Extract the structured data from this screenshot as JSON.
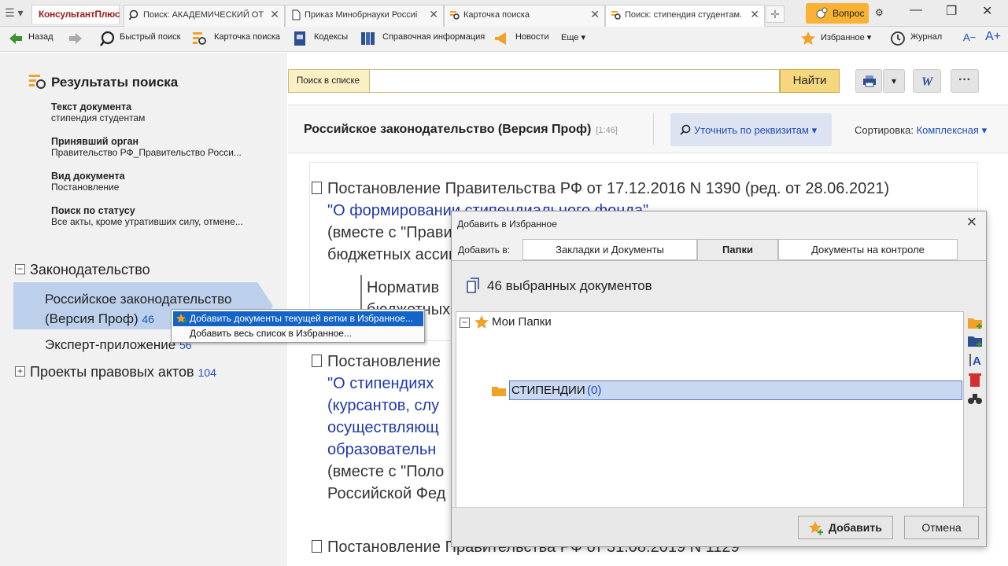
{
  "tabs": {
    "brand": "КонсультантПлюс",
    "items": [
      {
        "label": "Поиск: АКАДЕМИЧЕСКИЙ ОТ"
      },
      {
        "label": "Приказ Минобрнауки Россиі"
      },
      {
        "label": "Карточка поиска"
      },
      {
        "label": "Поиск: стипендия студентам."
      }
    ],
    "question_button": "Вопрос"
  },
  "toolbar": {
    "back": "Назад",
    "quick_search": "Быстрый поиск",
    "search_card": "Карточка поиска",
    "codexes": "Кодексы",
    "reference": "Справочная информация",
    "news": "Новости",
    "more": "Еще",
    "favorites": "Избранное",
    "journal": "Журнал",
    "font_smaller": "A−",
    "font_larger": "A+"
  },
  "left": {
    "title": "Результаты поиска",
    "criteria": [
      {
        "label": "Текст документа",
        "value": "стипендия студентам"
      },
      {
        "label": "Принявший орган",
        "value": "Правительство РФ_Правительство Росси..."
      },
      {
        "label": "Вид документа",
        "value": "Постановление"
      },
      {
        "label": "Поиск по статусу",
        "value": "Все акты, кроме утративших силу, отмене..."
      }
    ],
    "tree": {
      "legislation": "Законодательство",
      "rus_leg_line1": "Российское законодательство",
      "rus_leg_line2": "(Версия Проф)",
      "rus_leg_count": "46",
      "expert": "Эксперт-приложение",
      "expert_count": "56",
      "projects": "Проекты правовых актов",
      "projects_count": "104"
    }
  },
  "context_menu": {
    "item1": "Добавить документы текущей ветки в Избранное...",
    "item2": "Добавить весь список в Избранное..."
  },
  "search": {
    "label": "Поиск в списке",
    "value": "",
    "button": "Найти"
  },
  "results": {
    "title": "Российское законодательство (Версия Проф)",
    "range": "[1:46]",
    "refine": "Уточнить по реквизитам",
    "sort_label": "Сортировка:",
    "sort_value": "Комплексная",
    "docs": [
      {
        "line1": "Постановление Правительства РФ от 17.12.2016 N 1390 (ред. от 28.06.2021)",
        "line2": "\"О формировании стипендиального фонда\"",
        "line3": "(вместе с \"Прави",
        "line4": "бюджетных ассиг",
        "sub1": "Норматив",
        "sub2": "бюджетных"
      },
      {
        "line1": "Постановление",
        "line2": "\"О стипендиях",
        "line3": "(курсантов, слу",
        "line4": "осуществляющ",
        "line5": "образовательн",
        "line6": "(вместе с \"Поло",
        "line7": "Российской Фед"
      },
      {
        "line1": "Постановление Правительства РФ от 31.08.2019 N 1129"
      }
    ]
  },
  "dialog": {
    "title": "Добавить в Избранное",
    "add_to": "Добавить в:",
    "tabs": [
      "Закладки и Документы",
      "Папки",
      "Документы на контроле"
    ],
    "selected": "46 выбранных документов",
    "root_folder": "Мои Папки",
    "folder_name": "СТИПЕНДИИ",
    "folder_count": "0",
    "btn_add": "Добавить",
    "btn_cancel": "Отмена"
  },
  "colors": {
    "accent_yellow": "#f4d77e",
    "link_blue": "#1f4fb8",
    "selection": "#bcd0ec",
    "menu_highlight": "#1464c8"
  }
}
